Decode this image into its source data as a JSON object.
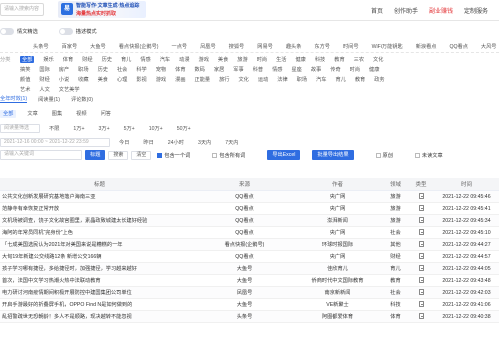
{
  "topbar": {
    "search_placeholder": "请输入搜索内容",
    "banner_line1": "智能写作·文章生成·热点追踪",
    "banner_line2": "海量热点实时抓取",
    "nav": [
      "首页",
      "创作助手",
      "副业赚钱",
      "定制服务"
    ]
  },
  "toggles": {
    "label1": "情文精选",
    "label2": "描述模式"
  },
  "category_rows": [
    {
      "label": "",
      "items": [
        "",
        "头条号",
        "百家号",
        "大鱼号",
        "看点快报(企鹅号)",
        "一点号",
        "凤凰号",
        "搜狐号",
        "网易号",
        "趣头条",
        "东方号",
        "时间号",
        "WiFi万能钥匙",
        "新浪看点",
        "QQ看点",
        "大风号"
      ]
    },
    {
      "label": "分类",
      "items": [
        "全部",
        "娱乐",
        "体育",
        "财经",
        "历史",
        "育儿",
        "情感",
        "汽车",
        "动漫",
        "游戏",
        "美食",
        "旅游",
        "时尚",
        "生活",
        "健康",
        "科技",
        "教育",
        "三农",
        "文化"
      ],
      "selected": 0
    },
    {
      "label": "",
      "items": [
        "搞笑",
        "国际",
        "房产",
        "职场",
        "历史",
        "社会",
        "科学",
        "宠物",
        "体育",
        "数码",
        "家居",
        "军事",
        "科普",
        "情感",
        "星座",
        "故事",
        "传奇",
        "时尚",
        "健康"
      ]
    },
    {
      "label": "",
      "items": [
        "颜值",
        "财经",
        "小说",
        "收藏",
        "美食",
        "心理",
        "影视",
        "游戏",
        "漫画",
        "正能量",
        "旅行",
        "文化",
        "运动",
        "法律",
        "职场",
        "汽车",
        "育儿",
        "教育",
        "政务"
      ]
    },
    {
      "label": "",
      "items": [
        "艺术",
        "人文",
        "文艺美学"
      ]
    }
  ],
  "tabs": {
    "items": [
      "全年时效",
      "阅读量",
      "评论数"
    ],
    "counts": [
      "(1)",
      "(1)",
      "(0)"
    ],
    "selected": 0
  },
  "sort": {
    "items": [
      "全部",
      "文章",
      "图集",
      "视频",
      "问答"
    ],
    "selected": 0
  },
  "filter1": {
    "label": "阅读量筛选",
    "placeholder": "请输入",
    "chips": [
      "不限",
      "1万+",
      "3万+",
      "5万+",
      "10万+",
      "50万+"
    ]
  },
  "filter2": {
    "date_start": "2021-12-16 00:00",
    "date_end": "2021-12-22 23:59",
    "chips": [
      "今日",
      "昨日",
      "24小时",
      "3天内",
      "7天内"
    ]
  },
  "filter3": {
    "placeholder": "请输入关键词",
    "btn_search": "标题",
    "btn_query": "搜索",
    "btn_clear": "清空",
    "check_all": "包含一个词",
    "check_exact": "包含所有词",
    "btn_export": "导出Excel",
    "btn_custom": "批量导出结果",
    "check_orig": "原创",
    "check_unread": "未读文章"
  },
  "table": {
    "headers": [
      "标题",
      "来源",
      "作者",
      "领域",
      "类型",
      "时间"
    ],
    "rows": [
      [
        "公共文化创新发展研究基地落户海南三亚",
        "QQ看点",
        "央广网",
        "旅游",
        "2021-12-22 09:45:46"
      ],
      [
        "范静寺有幸恢复正常开放",
        "QQ看点",
        "央广网",
        "旅游",
        "2021-12-22 09:45:41"
      ],
      [
        "文机场被调查，饶子文化故宫圈里，素晶政致城建太长建好经验",
        "QQ看点",
        "澎湃新闻",
        "旅游",
        "2021-12-22 09:45:34"
      ],
      [
        "海阿的年常员同机“完身份”上色",
        "QQ看点",
        "央广网",
        "社会",
        "2021-12-22 09:45:10"
      ],
      [
        "「七成美国选民认为2021年对美国来说是糟糕的一年",
        "看点快报(企鹅号)",
        "环球时报国际",
        "其他",
        "2021-12-22 09:44:27"
      ],
      [
        "大旬19年新建公交线路12条 新增公交166辆",
        "QQ看点",
        "央广网",
        "财经",
        "2021-12-22 09:44:57"
      ],
      [
        "孩子学习哪有捷径，多给捷径时，加强捷径，学习越来越好",
        "大鱼号",
        "佳欣育儿",
        "育儿",
        "2021-12-22 09:44:05"
      ],
      [
        "首次，法国中文学习热潮火热中法联动教育",
        "大鱼号",
        "侨商时代中文国际教育",
        "教育",
        "2021-12-22 09:43:48"
      ],
      [
        "电力研讨河南疫情期间积极开展防控中建国集团公司单位",
        "凤凰号",
        "南京新新闻",
        "社会",
        "2021-12-22 09:42:03"
      ],
      [
        "开启手游最好的折叠屏手机，OPPO Find N是如何做到的",
        "大鱼号",
        "VE新聚士",
        "科技",
        "2021-12-22 09:41:06"
      ],
      [
        "乱招警疏世无恐朝龄！多人不是顺路，现决越转不能忽视",
        "头条号",
        "阿图都爱体育",
        "体育",
        "2021-12-22 09:40:38"
      ]
    ]
  }
}
